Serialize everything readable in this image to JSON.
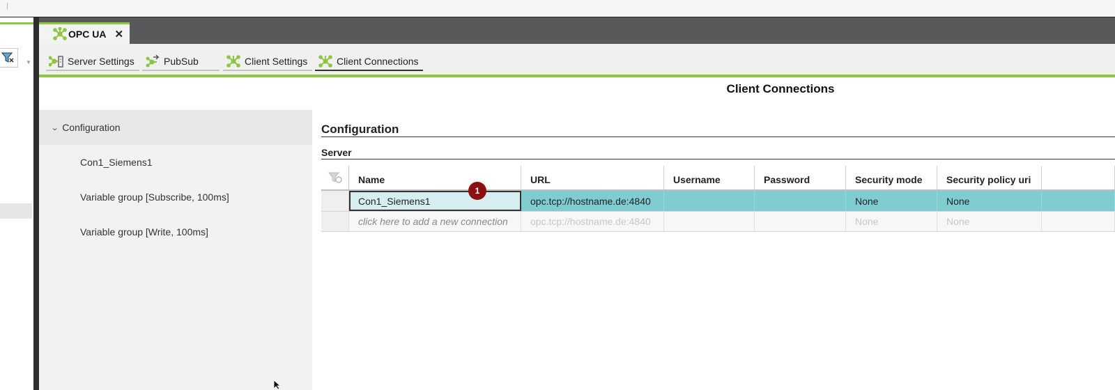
{
  "colors": {
    "accent": "#8dc63f",
    "tab_bar": "#58595b",
    "row_selected": "#7fccd1",
    "marker": "#8b1010"
  },
  "tab": {
    "label": "OPC UA",
    "icon": "network-icon",
    "close": "✕"
  },
  "subtabs": [
    {
      "label": "Server Settings",
      "icon": "server-settings-icon"
    },
    {
      "label": "PubSub",
      "icon": "pubsub-icon"
    },
    {
      "label": "Client Settings",
      "icon": "network-icon"
    },
    {
      "label": "Client Connections",
      "icon": "network-icon",
      "active": true
    }
  ],
  "page_title": "Client Connections",
  "tree": {
    "header": "Configuration",
    "items": [
      {
        "label": "Con1_Siemens1"
      },
      {
        "label": "Variable group [Subscribe, 100ms]"
      },
      {
        "label": "Variable group [Write, 100ms]"
      }
    ]
  },
  "main": {
    "section_title": "Configuration",
    "sub_title": "Server"
  },
  "grid": {
    "columns": [
      "Name",
      "URL",
      "Username",
      "Password",
      "Security mode",
      "Security policy uri",
      ""
    ],
    "rows": [
      {
        "name": "Con1_Siemens1",
        "url": "opc.tcp://hostname.de:4840",
        "username": "",
        "password": "",
        "security_mode": "None",
        "security_policy": "None"
      }
    ],
    "new_row": {
      "name": "click here to add a new connection",
      "url": "opc.tcp://hostname.de:4840",
      "username": "",
      "password": "",
      "security_mode": "None",
      "security_policy": "None"
    }
  },
  "marker": "1"
}
